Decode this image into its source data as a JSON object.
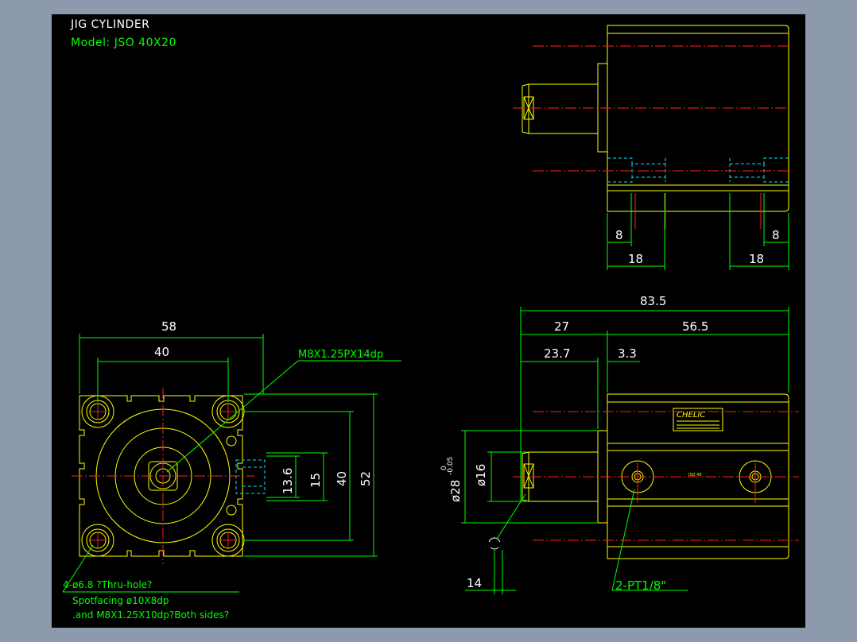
{
  "drawing": {
    "title": "JIG CYLINDER",
    "model": "Model:  JSO 40X20"
  },
  "front_view": {
    "dim_width_outer": "58",
    "dim_width_inner": "40",
    "dim_height_outer": "52",
    "dim_height_inner": "40",
    "dim_slot_15": "15",
    "dim_slot_13_6": "13.6",
    "callout_thread": "M8X1.25PX14dp",
    "note_line1": "4-ø6.8 ?Thru-hole?",
    "note_line2": "Spotfacing ø10X8dp",
    "note_line3": ".and M8X1.25X10dp?Both sides?"
  },
  "top_view": {
    "dim_left_8": "8",
    "dim_right_8": "8",
    "dim_left_18": "18",
    "dim_right_18": "18"
  },
  "side_view": {
    "dim_total": "83.5",
    "dim_27": "27",
    "dim_56_5": "56.5",
    "dim_23_7": "23.7",
    "dim_3_3": "3.3",
    "dim_rod_dia": "ø16",
    "dim_body_dia": "ø28",
    "tol_upper": "0",
    "tol_lower": "-0.05",
    "dim_14": "14",
    "callout_port": "2-PT1/8\"",
    "brand": "CHELIC",
    "plate_model": "JSO 40"
  }
}
